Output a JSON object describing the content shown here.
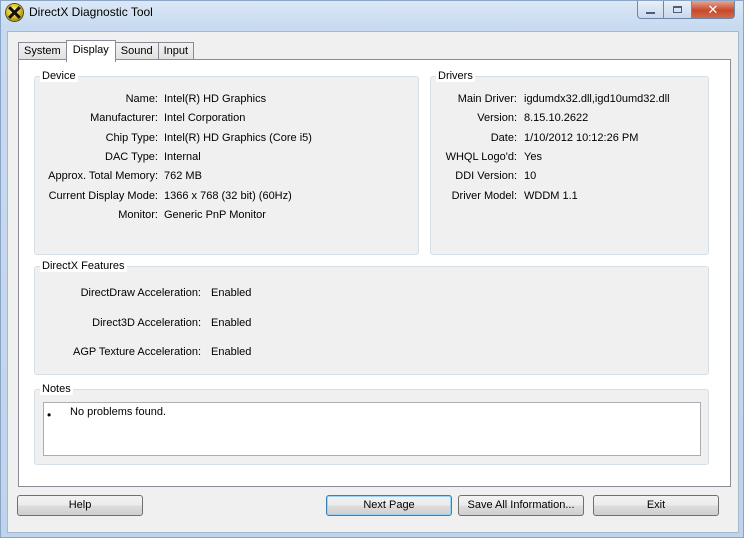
{
  "window": {
    "title": "DirectX Diagnostic Tool",
    "close_glyph": "✕"
  },
  "tabs": [
    {
      "label": "System",
      "active": false
    },
    {
      "label": "Display",
      "active": true
    },
    {
      "label": "Sound",
      "active": false
    },
    {
      "label": "Input",
      "active": false
    }
  ],
  "device": {
    "title": "Device",
    "rows": [
      {
        "label": "Name:",
        "value": "Intel(R) HD Graphics"
      },
      {
        "label": "Manufacturer:",
        "value": "Intel Corporation"
      },
      {
        "label": "Chip Type:",
        "value": "Intel(R) HD Graphics (Core i5)"
      },
      {
        "label": "DAC Type:",
        "value": "Internal"
      },
      {
        "label": "Approx. Total Memory:",
        "value": "762 MB"
      },
      {
        "label": "Current Display Mode:",
        "value": "1366 x 768 (32 bit) (60Hz)"
      },
      {
        "label": "Monitor:",
        "value": "Generic PnP Monitor"
      }
    ]
  },
  "drivers": {
    "title": "Drivers",
    "rows": [
      {
        "label": "Main Driver:",
        "value": "igdumdx32.dll,igd10umd32.dll"
      },
      {
        "label": "Version:",
        "value": "8.15.10.2622"
      },
      {
        "label": "Date:",
        "value": "1/10/2012 10:12:26 PM"
      },
      {
        "label": "WHQL Logo'd:",
        "value": "Yes"
      },
      {
        "label": "DDI Version:",
        "value": "10"
      },
      {
        "label": "Driver Model:",
        "value": "WDDM 1.1"
      }
    ]
  },
  "features": {
    "title": "DirectX Features",
    "rows": [
      {
        "label": "DirectDraw Acceleration:",
        "value": "Enabled"
      },
      {
        "label": "Direct3D Acceleration:",
        "value": "Enabled"
      },
      {
        "label": "AGP Texture Acceleration:",
        "value": "Enabled"
      }
    ]
  },
  "notes": {
    "title": "Notes",
    "bullet": "•",
    "text": "No problems found."
  },
  "buttons": {
    "help": "Help",
    "next_page": "Next Page",
    "save_all": "Save All Information...",
    "exit": "Exit"
  }
}
